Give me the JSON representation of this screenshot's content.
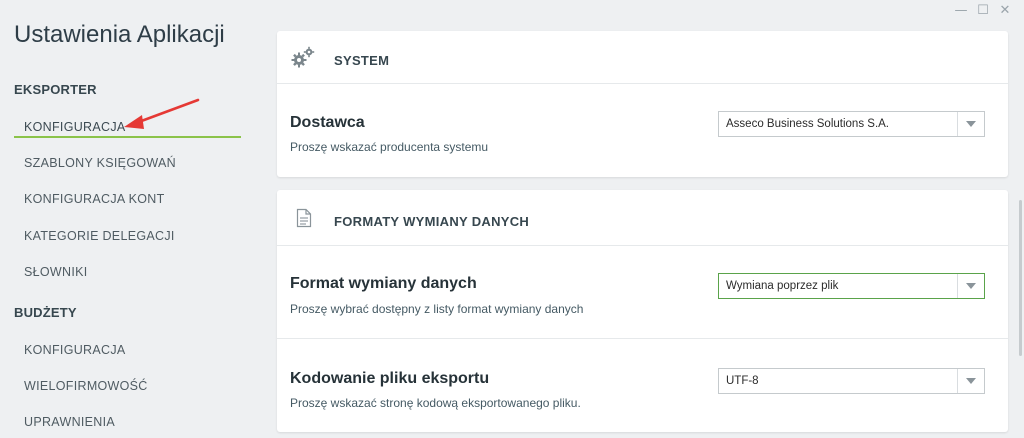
{
  "window": {
    "minimize_glyph": "—",
    "maximize_glyph": "☐",
    "close_glyph": "✕"
  },
  "sidebar": {
    "title": "Ustawienia Aplikacji",
    "sections": [
      {
        "heading": "EKSPORTER",
        "items": [
          {
            "label": "KONFIGURACJA",
            "active": true
          },
          {
            "label": "SZABLONY KSIĘGOWAŃ"
          },
          {
            "label": "KONFIGURACJA KONT"
          },
          {
            "label": "KATEGORIE DELEGACJI"
          },
          {
            "label": "SŁOWNIKI"
          }
        ]
      },
      {
        "heading": "BUDŻETY",
        "items": [
          {
            "label": "KONFIGURACJA"
          },
          {
            "label": "WIELOFIRMOWOŚĆ"
          },
          {
            "label": "UPRAWNIENIA"
          }
        ]
      }
    ],
    "accent_color": "#8bc34a",
    "arrow_color": "#e53935"
  },
  "main": {
    "system_card": {
      "title": "SYSTEM",
      "icon": "gears-icon",
      "rows": [
        {
          "label": "Dostawca",
          "description": "Proszę wskazać producenta systemu",
          "selected": "Asseco Business Solutions S.A."
        }
      ]
    },
    "formats_card": {
      "title": "FORMATY WYMIANY DANYCH",
      "icon": "document-icon",
      "rows": [
        {
          "label": "Format wymiany danych",
          "description": "Proszę wybrać dostępny z listy format wymiany danych",
          "selected": "Wymiana poprzez plik"
        },
        {
          "label": "Kodowanie pliku eksportu",
          "description": "Proszę wskazać stronę kodową eksportowanego pliku.",
          "selected": "UTF-8"
        }
      ]
    }
  }
}
